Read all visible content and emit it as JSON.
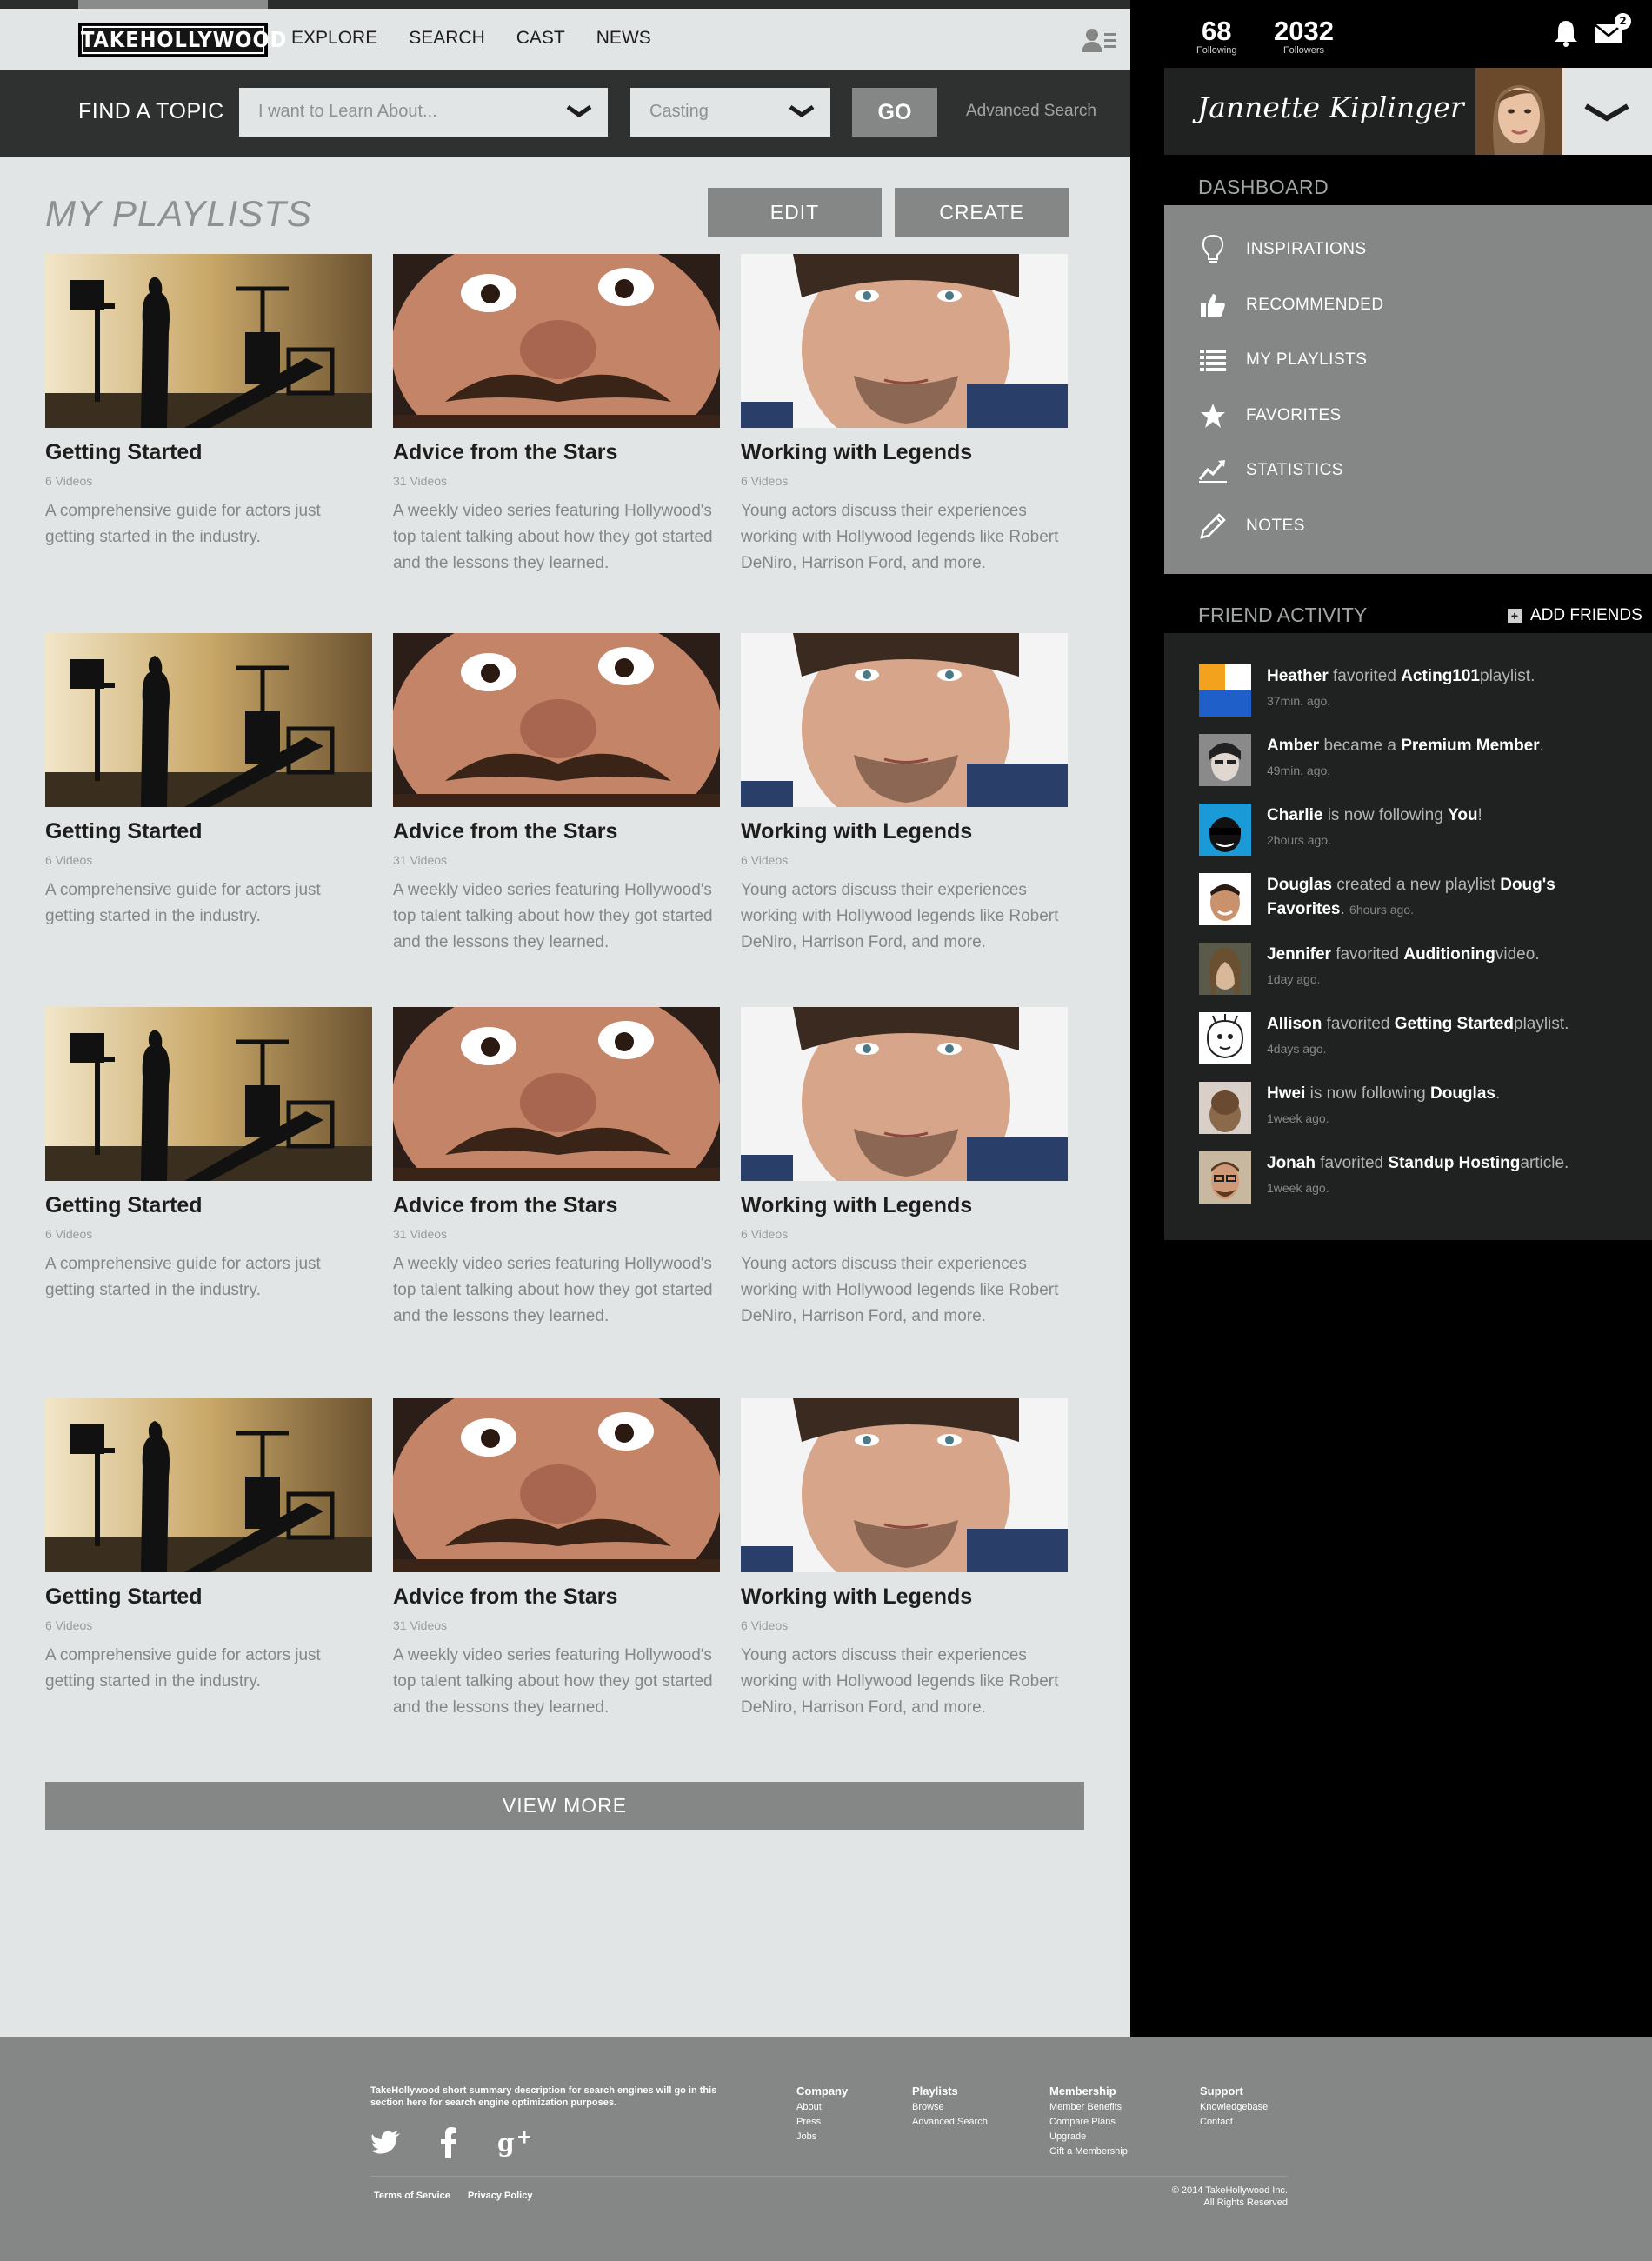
{
  "brand": {
    "logo_text": "TAKEHOLLYWOOD"
  },
  "nav": [
    "EXPLORE",
    "SEARCH",
    "CAST",
    "NEWS"
  ],
  "search": {
    "label": "FIND A TOPIC",
    "topic_placeholder": "I want to Learn About...",
    "category_value": "Casting",
    "go_label": "GO",
    "advanced_label": "Advanced Search"
  },
  "playlists": {
    "title": "MY PLAYLISTS",
    "edit_label": "EDIT",
    "create_label": "CREATE",
    "view_more_label": "VIEW MORE",
    "rows": [
      [
        {
          "title": "Getting Started",
          "count": "6 Videos",
          "desc": "A comprehensive guide for actors just getting started in the industry.",
          "thumb": "studio"
        },
        {
          "title": "Advice from the Stars",
          "count": "31 Videos",
          "desc": "A weekly video series featuring Hollywood's top talent talking about how they got started and the lessons they learned.",
          "thumb": "face-funny"
        },
        {
          "title": "Working with Legends",
          "count": "6 Videos",
          "desc": "Young actors discuss their experiences working with Hollywood legends like Robert DeNiro, Harrison Ford, and more.",
          "thumb": "face-actor"
        }
      ],
      [
        {
          "title": "Getting Started",
          "count": "6 Videos",
          "desc": "A comprehensive guide for actors just getting started in the industry.",
          "thumb": "studio"
        },
        {
          "title": "Advice from the Stars",
          "count": "31 Videos",
          "desc": "A weekly video series featuring Hollywood's top talent talking about how they got started and the lessons they learned.",
          "thumb": "face-funny"
        },
        {
          "title": "Working with Legends",
          "count": "6 Videos",
          "desc": "Young actors discuss their experiences working with Hollywood legends like Robert DeNiro, Harrison Ford, and more.",
          "thumb": "face-actor"
        }
      ],
      [
        {
          "title": "Getting Started",
          "count": "6 Videos",
          "desc": "A comprehensive guide for actors just getting started in the industry.",
          "thumb": "studio"
        },
        {
          "title": "Advice from the Stars",
          "count": "31 Videos",
          "desc": "A weekly video series featuring Hollywood's top talent talking about how they got started and the lessons they learned.",
          "thumb": "face-funny"
        },
        {
          "title": "Working with Legends",
          "count": "6 Videos",
          "desc": "Young actors discuss their experiences working with Hollywood legends like Robert DeNiro, Harrison Ford, and more.",
          "thumb": "face-actor"
        }
      ],
      [
        {
          "title": "Getting Started",
          "count": "6 Videos",
          "desc": "A comprehensive guide for actors just getting started in the industry.",
          "thumb": "studio"
        },
        {
          "title": "Advice from the Stars",
          "count": "31 Videos",
          "desc": "A weekly video series featuring Hollywood's top talent talking about how they got started and the lessons they learned.",
          "thumb": "face-funny"
        },
        {
          "title": "Working with Legends",
          "count": "6 Videos",
          "desc": "Young actors discuss their experiences working with Hollywood legends like Robert DeNiro, Harrison Ford, and more.",
          "thumb": "face-actor"
        }
      ]
    ]
  },
  "stats": {
    "following": {
      "value": "68",
      "label": "Following"
    },
    "followers": {
      "value": "2032",
      "label": "Followers"
    },
    "mail_badge": "2"
  },
  "profile": {
    "name": "Jannette Kiplinger"
  },
  "dashboard": {
    "title": "DASHBOARD",
    "items": [
      {
        "label": "INSPIRATIONS",
        "icon": "lightbulb-icon"
      },
      {
        "label": "RECOMMENDED",
        "icon": "thumbs-up-icon"
      },
      {
        "label": "MY PLAYLISTS",
        "icon": "list-icon"
      },
      {
        "label": "FAVORITES",
        "icon": "star-icon"
      },
      {
        "label": "STATISTICS",
        "icon": "trend-icon"
      },
      {
        "label": "NOTES",
        "icon": "pencil-icon"
      }
    ]
  },
  "friend_activity": {
    "title": "FRIEND ACTIVITY",
    "add_label": "ADD FRIENDS",
    "items": [
      {
        "name": "Heather",
        "action": "favorited",
        "target": "Acting101",
        "suffix": "playlist.",
        "time": "37min. ago."
      },
      {
        "name": "Amber",
        "action": "became a",
        "target": "Premium Member",
        "suffix": ".",
        "time": "49min. ago."
      },
      {
        "name": "Charlie",
        "action": "is now following",
        "target": "You",
        "suffix": "!",
        "time": "2hours ago."
      },
      {
        "name": "Douglas",
        "action": "created a new playlist",
        "target": "Doug's Favorites",
        "suffix": ".",
        "time": "6hours ago."
      },
      {
        "name": "Jennifer",
        "action": "favorited",
        "target": "Auditioning",
        "suffix": "video.",
        "time": "1day ago."
      },
      {
        "name": "Allison",
        "action": "favorited",
        "target": "Getting Started",
        "suffix": "playlist.",
        "time": "4days ago."
      },
      {
        "name": "Hwei",
        "action": "is now following",
        "target": "Douglas",
        "suffix": ".",
        "time": "1week ago."
      },
      {
        "name": "Jonah",
        "action": "favorited",
        "target": "Standup Hosting",
        "suffix": "article.",
        "time": "1week ago."
      }
    ]
  },
  "footer": {
    "description": "TakeHollywood short summary description for  search engines will go in this section here for search engine optimization purposes.",
    "columns": [
      {
        "heading": "Company",
        "links": [
          "About",
          "Press",
          "Jobs"
        ]
      },
      {
        "heading": "Playlists",
        "links": [
          "Browse",
          "Advanced Search"
        ]
      },
      {
        "heading": "Membership",
        "links": [
          "Member Benefits",
          "Compare Plans",
          "Upgrade",
          "Gift a Membership"
        ]
      },
      {
        "heading": "Support",
        "links": [
          "Knowledgebase",
          "Contact"
        ]
      }
    ],
    "terms": "Terms of Service",
    "privacy": "Privacy Policy",
    "copyright_1": "© 2014 TakeHollywood Inc.",
    "copyright_2": "All Rights Reserved"
  }
}
